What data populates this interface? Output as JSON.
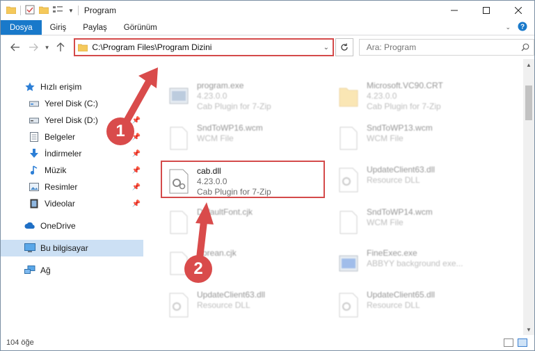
{
  "window": {
    "title": "Program"
  },
  "ribbon": {
    "tabs": [
      "Dosya",
      "Giriş",
      "Paylaş",
      "Görünüm"
    ]
  },
  "address": {
    "path": "C:\\Program Files\\Program Dizini"
  },
  "search": {
    "placeholder": "Ara: Program"
  },
  "sidebar": {
    "items": [
      {
        "label": "Hızlı erişim",
        "icon": "star-icon"
      },
      {
        "label": "Yerel Disk (C:)",
        "icon": "drive-icon"
      },
      {
        "label": "Yerel Disk (D:)",
        "icon": "drive-icon"
      },
      {
        "label": "Belgeler",
        "icon": "documents-icon"
      },
      {
        "label": "İndirmeler",
        "icon": "download-icon"
      },
      {
        "label": "Müzik",
        "icon": "music-icon"
      },
      {
        "label": "Resimler",
        "icon": "pictures-icon"
      },
      {
        "label": "Videolar",
        "icon": "video-icon"
      },
      {
        "label": "OneDrive",
        "icon": "cloud-icon"
      },
      {
        "label": "Bu bilgisayar",
        "icon": "computer-icon"
      },
      {
        "label": "Ağ",
        "icon": "network-icon"
      }
    ]
  },
  "files": [
    {
      "name": "program.exe",
      "line2": "4.23.0.0",
      "line3": "Cab Plugin for 7-Zip",
      "icon": "exe-icon"
    },
    {
      "name": "Microsoft.VC90.CRT",
      "line2": "4.23.0.0",
      "line3": "Cab Plugin for 7-Zip",
      "icon": "folder-icon"
    },
    {
      "name": "SndToWP16.wcm",
      "line2": "WCM File",
      "line3": "",
      "icon": "file-icon"
    },
    {
      "name": "SndToWP13.wcm",
      "line2": "WCM File",
      "line3": "",
      "icon": "file-icon"
    },
    {
      "name": "cab.dll",
      "line2": "4.23.0.0",
      "line3": "Cab Plugin for 7-Zip",
      "icon": "dll-icon"
    },
    {
      "name": "UpdateClient63.dll",
      "line2": "Resource DLL",
      "line3": "",
      "icon": "dll-icon"
    },
    {
      "name": "DefaultFont.cjk",
      "line2": "",
      "line3": "",
      "icon": "file-icon"
    },
    {
      "name": "SndToWP14.wcm",
      "line2": "WCM File",
      "line3": "",
      "icon": "file-icon"
    },
    {
      "name": "Korean.cjk",
      "line2": "File",
      "line3": "",
      "icon": "file-icon"
    },
    {
      "name": "FineExec.exe",
      "line2": "ABBYY background exe...",
      "line3": "",
      "icon": "exe-icon"
    },
    {
      "name": "UpdateClient63.dll",
      "line2": "Resource DLL",
      "line3": "",
      "icon": "dll-icon"
    },
    {
      "name": "UpdateClient65.dll",
      "line2": "Resource DLL",
      "line3": "",
      "icon": "dll-icon"
    }
  ],
  "status": {
    "count": "104 öğe"
  },
  "callouts": {
    "one": "1",
    "two": "2"
  },
  "colors": {
    "accent": "#1979ca",
    "highlight": "#d44a4a",
    "selected": "#cce0f4"
  }
}
